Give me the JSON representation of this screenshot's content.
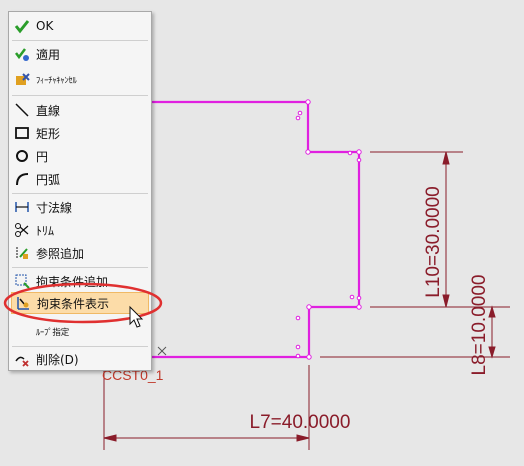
{
  "menu": {
    "items": [
      {
        "label": "OK",
        "icon": "check-icon"
      },
      {
        "label": "適用",
        "icon": "apply-icon"
      },
      {
        "label": "ﾌｨｰﾁｬｷｬﾝｾﾙ",
        "icon": "feature-cancel-icon"
      },
      {
        "label": "直線",
        "icon": "line-icon"
      },
      {
        "label": "矩形",
        "icon": "rectangle-icon"
      },
      {
        "label": "円",
        "icon": "circle-icon"
      },
      {
        "label": "円弧",
        "icon": "arc-icon"
      },
      {
        "label": "寸法線",
        "icon": "dimension-icon"
      },
      {
        "label": "ﾄﾘﾑ",
        "icon": "trim-icon"
      },
      {
        "label": "参照追加",
        "icon": "reference-add-icon"
      },
      {
        "label": "拘束条件追加",
        "icon": "constraint-add-icon"
      },
      {
        "label": "拘束条件表示",
        "icon": "constraint-show-icon"
      },
      {
        "label": "ﾙｰﾌﾟ指定",
        "icon": ""
      },
      {
        "label": "削除(D)",
        "icon": "delete-icon"
      }
    ],
    "highlighted": "拘束条件表示"
  },
  "drawing": {
    "dimensions": [
      "L10=30.0000",
      "L8=10.0000",
      "L7=40.0000"
    ],
    "constraint_tag": "CCST0_1",
    "colors": {
      "profile": "#e020e0",
      "dimension": "#8a1c2a",
      "annotation": "#c0392b"
    }
  }
}
